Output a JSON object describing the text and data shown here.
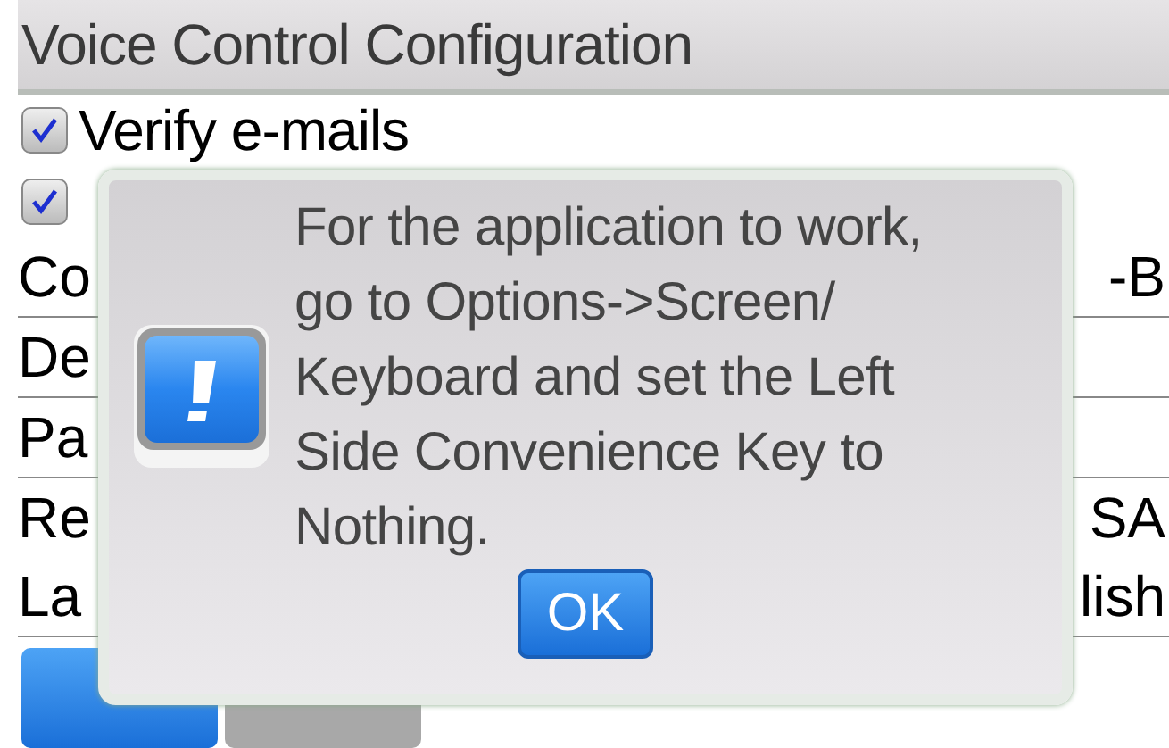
{
  "screen": {
    "title": "Voice Control Configuration"
  },
  "checkboxes": [
    {
      "label": "Verify e-mails",
      "checked": true
    },
    {
      "checked": true
    }
  ],
  "fields": [
    {
      "label": "Co",
      "value": "-B"
    },
    {
      "label": "De"
    },
    {
      "label": "Pa"
    },
    {
      "label": "Re",
      "value": "SA"
    },
    {
      "label": "La",
      "value": "lish"
    }
  ],
  "buttons": [
    {
      "disabled": false
    },
    {
      "disabled": true
    }
  ],
  "dialog": {
    "message_lines": [
      "For the application to work,",
      "go to Options->Screen/",
      "Keyboard and set the Left",
      "Side Convenience Key to",
      "Nothing."
    ],
    "button": "OK"
  }
}
